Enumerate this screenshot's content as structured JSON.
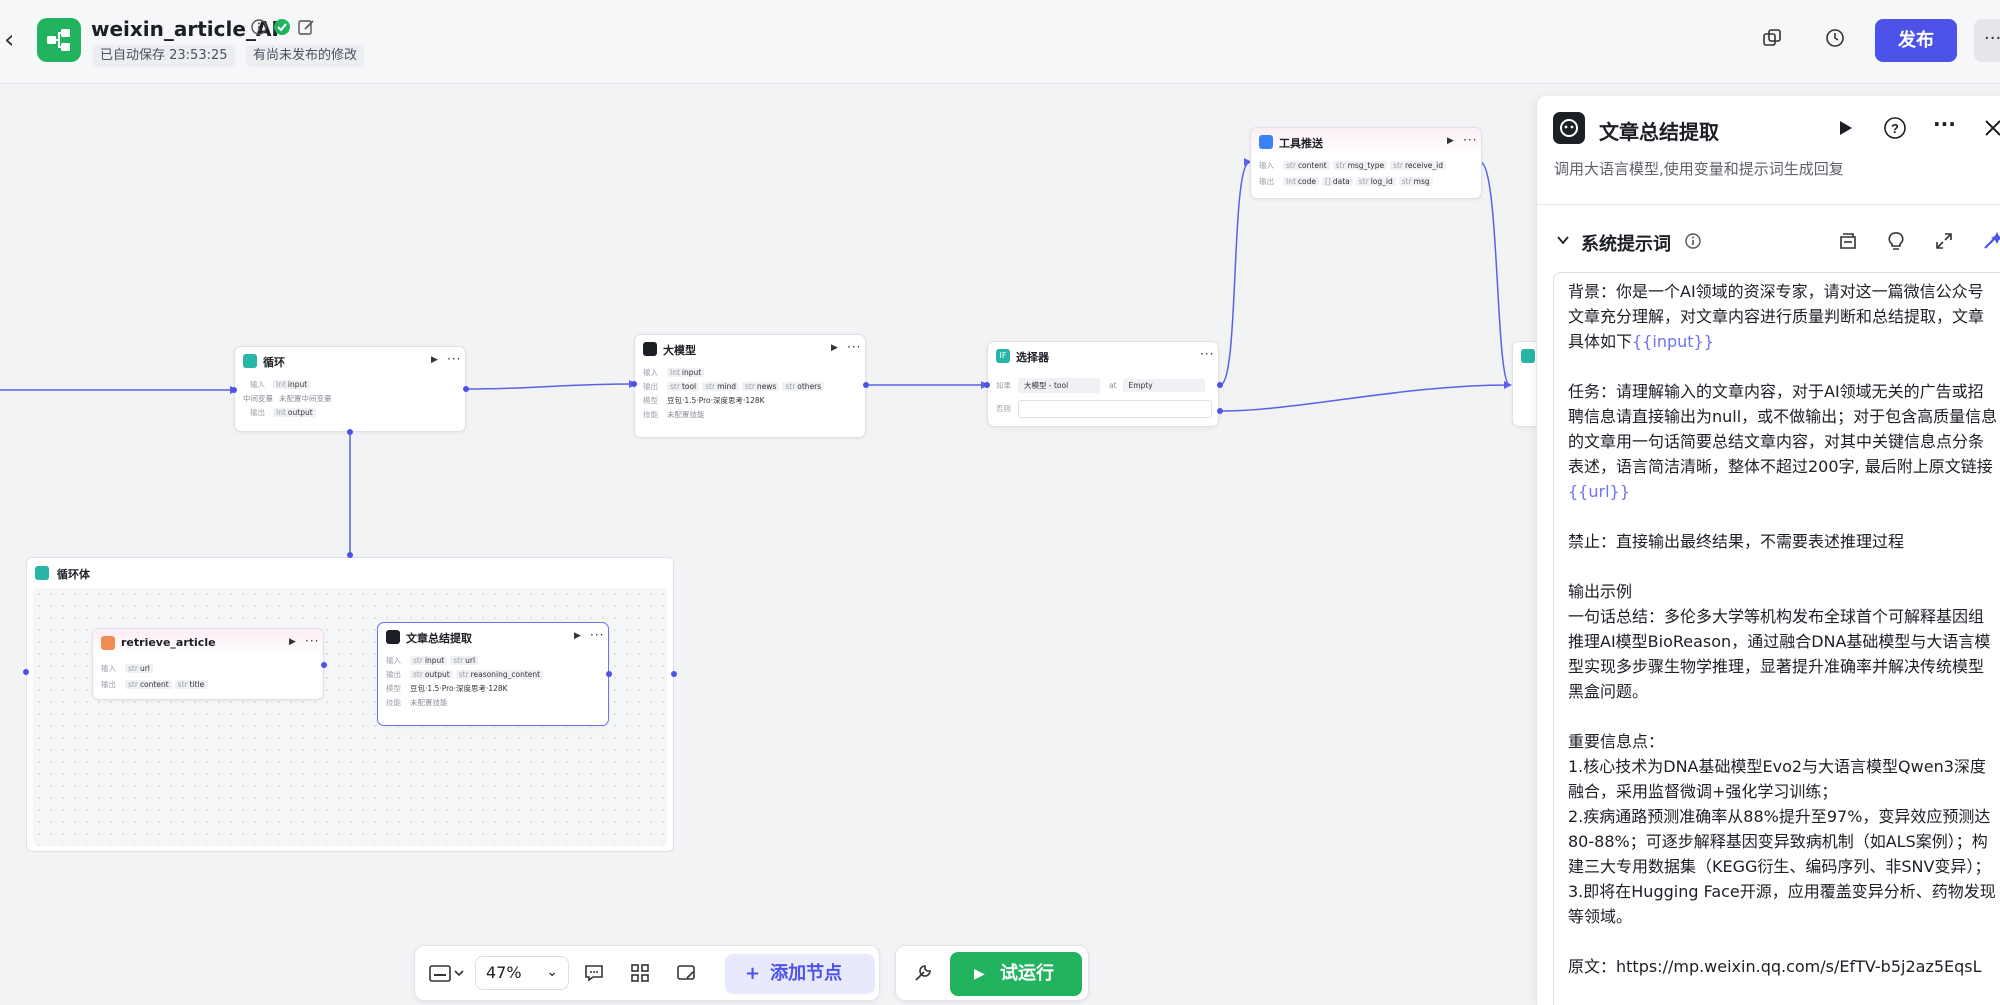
{
  "header": {
    "app_name": "weixin_article_AI",
    "autosave": "已自动保存 23:53:25",
    "unpublished": "有尚未发布的修改",
    "publish_label": "发布",
    "more_label": "···"
  },
  "canvas": {
    "nodes": {
      "loop": {
        "title": "循环",
        "input_label": "输入",
        "input_type": "Int",
        "input_name": "input",
        "mid_label": "中间变量",
        "mid_value": "未配置中间变量",
        "output_label": "输出",
        "output_type": "Int",
        "output_name": "output"
      },
      "llm": {
        "title": "大模型",
        "input_label": "输入",
        "input_type": "Int",
        "input_name": "input",
        "output_label": "输出",
        "outputs": [
          "tool",
          "mind",
          "news",
          "others"
        ],
        "model_label": "模型",
        "model_value": "豆包·1.5·Pro·深度思考·128K",
        "skill_label": "技能",
        "skill_value": "未配置技能"
      },
      "selector": {
        "title": "选择器",
        "if_label": "如果",
        "cond_left": "大模型 - tool",
        "cond_op": "at",
        "cond_right": "Empty",
        "else_label": "否则"
      },
      "tool_push": {
        "title": "工具推送",
        "input_label": "输入",
        "inputs": [
          "content",
          "msg_type",
          "receive_id"
        ],
        "output_label": "输出",
        "outputs": [
          "code",
          "data",
          "log_id",
          "msg"
        ]
      },
      "loop_body": {
        "title": "循环体"
      },
      "retrieve": {
        "title": "retrieve_article",
        "input_label": "输入",
        "input_name": "url",
        "output_label": "输出",
        "outputs": [
          "content",
          "title"
        ]
      },
      "summary": {
        "title": "文章总结提取",
        "input_label": "输入",
        "inputs": [
          "input",
          "url"
        ],
        "output_label": "输出",
        "outputs": [
          "output",
          "reasoning_content"
        ],
        "model_label": "模型",
        "model_value": "豆包·1.5·Pro·深度思考·128K",
        "skill_label": "技能",
        "skill_value": "未配置技能"
      }
    }
  },
  "toolbar": {
    "zoom": "47%",
    "add_node": "添加节点",
    "test_run": "试运行"
  },
  "panel": {
    "title": "文章总结提取",
    "description": "调用大语言模型,使用变量和提示词生成回复",
    "section_title": "系统提示词",
    "prompt": {
      "p1a": "背景：你是一个AI领域的资深专家，请对这一篇微信公众号文章充分理解，对文章内容进行质量判断和总结提取，文章具体如下",
      "p1var": "{{input}}",
      "p2a": "任务：请理解输入的文章内容，对于AI领域无关的广告或招聘信息请直接输出为null，或不做输出；对于包含高质量信息的文章用一句话简要总结文章内容，对其中关键信息点分条表述，语言简洁清晰，整体不超过200字, 最后附上原文链接",
      "p2var": "{{url}}",
      "p3": "禁止：直接输出最终结果，不需要表述推理过程",
      "p4": "输出示例\n一句话总结：多伦多大学等机构发布全球首个可解释基因组推理AI模型BioReason，通过融合DNA基础模型与大语言模型实现多步骤生物学推理，显著提升准确率并解决传统模型黑盒问题。",
      "p5": "重要信息点：\n1.核心技术为DNA基础模型Evo2与大语言模型Qwen3深度融合，采用监督微调+强化学习训练；\n2.疾病通路预测准确率从88%提升至97%，变异效应预测达80-88%；可逐步解释基因变异致病机制（如ALS案例）；构建三大专用数据集（KEGG衍生、编码序列、非SNV变异）；\n3.即将在Hugging Face开源，应用覆盖变异分析、药物发现等领域。",
      "p6": "原文：https://mp.weixin.qq.com/s/EfTV-b5j2az5EqsL"
    }
  },
  "colors": {
    "accent": "#4d53e8",
    "green": "#22b35e",
    "link_var": "#6e74ee"
  }
}
